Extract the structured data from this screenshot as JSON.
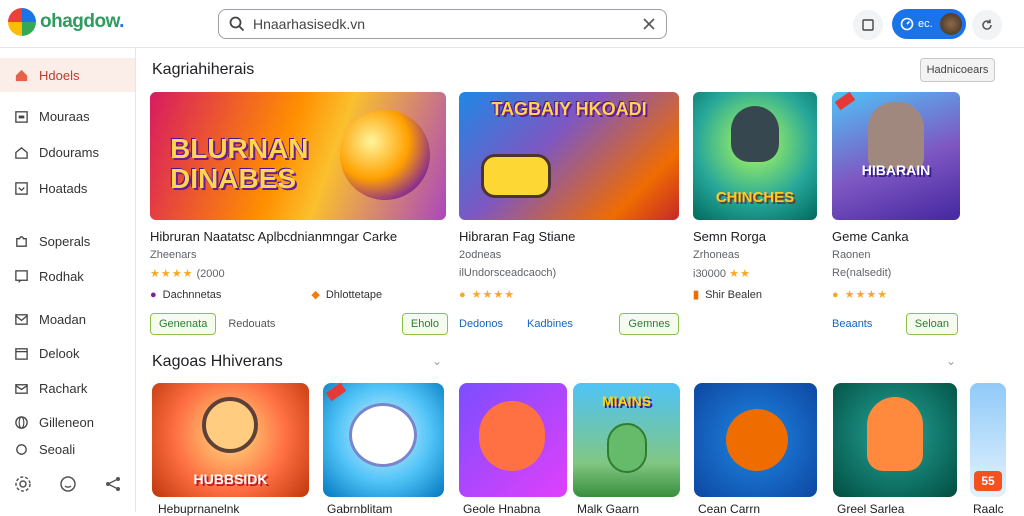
{
  "app": {
    "logo_text": "ohagdow",
    "logo_dot": "."
  },
  "search": {
    "value": "Hnaarhasisedk.vn"
  },
  "header": {
    "account_label": "ec."
  },
  "sidebar": {
    "items": [
      {
        "label": "Hdoels",
        "icon": "home-icon"
      },
      {
        "label": "Mouraas",
        "icon": "store-icon"
      },
      {
        "label": "Ddourams",
        "icon": "house-icon"
      },
      {
        "label": "Hoatads",
        "icon": "download-icon"
      },
      {
        "label": "Soperals",
        "icon": "puzzle-icon"
      },
      {
        "label": "Rodhak",
        "icon": "message-icon"
      },
      {
        "label": "Moadan",
        "icon": "mail-icon"
      },
      {
        "label": "Delook",
        "icon": "calendar-icon"
      },
      {
        "label": "Rachark",
        "icon": "envelope-icon"
      },
      {
        "label": "Gilleneon",
        "icon": "globe-icon"
      },
      {
        "label": "Seoali",
        "icon": "settings-icon"
      }
    ],
    "bottom_icons": [
      "settings-gear-icon",
      "smiley-icon",
      "share-icon"
    ]
  },
  "section1": {
    "title": "Kagriahiherais",
    "action": "Hadnicoears",
    "cards": [
      {
        "art": "BLURNAN DINABES",
        "title": "Hibruran Naatatsc Aplbcdnianmngar Carke",
        "sub": "Zheenars",
        "rating": "★★★★",
        "rating_text": "(2000",
        "tag1": "Dachnnetas",
        "tag2": "Dhlottetape",
        "btn": "Genenata",
        "link": "Redouats",
        "btn2": "Eholo"
      },
      {
        "art": "TAGBAIY HKOADI",
        "title": "Hibraran Fag Stiane",
        "sub": "2odneas",
        "rating": "★★★★",
        "rating_text": "ilUndorsceadcaoch)",
        "tag1": "",
        "tag2": "",
        "btn": "Dedonos",
        "link": "Kadbines",
        "btn2": "Gemnes"
      },
      {
        "art": "CHINCHES",
        "title": "Semn Rorga",
        "sub": "Zrhoneas",
        "rating": "★★",
        "rating_text": "i30000",
        "tag1": "Shir Bealen",
        "tag2": "",
        "btn": "",
        "link": "",
        "btn2": ""
      },
      {
        "art": "HIBARAIN",
        "title": "Geme Canka",
        "sub": "Raonen",
        "rating": "",
        "rating_text": "Re(nalsedit)",
        "tag1": "",
        "tag2": "",
        "btn": "Beaants",
        "link": "",
        "btn2": "Seloan"
      }
    ]
  },
  "section2": {
    "title": "Kagoas Hhiverans",
    "items": [
      {
        "art": "HUBBSIDK",
        "title": "Hebuprnanelnk"
      },
      {
        "art": "",
        "title": "Gabrnblitam"
      },
      {
        "art": "",
        "title": "Geole Hnabna"
      },
      {
        "art": "MIAINS",
        "title": "Malk Gaarn"
      },
      {
        "art": "",
        "title": "Cean Carrn"
      },
      {
        "art": "",
        "title": "Greel Sarlea"
      },
      {
        "art": "55",
        "title": "Raalc"
      }
    ]
  },
  "colors": {
    "accent": "#1a73e8",
    "active_bg": "#fbeee8",
    "active_text": "#c0392b",
    "green": "#8bc34a"
  }
}
